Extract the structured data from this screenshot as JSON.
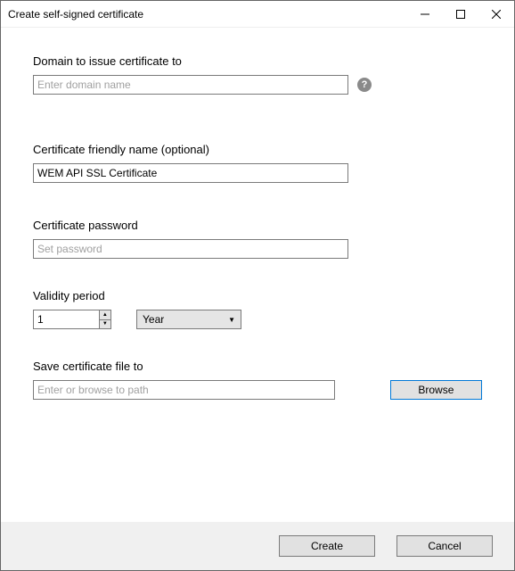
{
  "window": {
    "title": "Create self-signed certificate"
  },
  "fields": {
    "domain": {
      "label": "Domain to issue certificate to",
      "placeholder": "Enter domain name",
      "value": ""
    },
    "friendlyName": {
      "label": "Certificate friendly name (optional)",
      "value": "WEM API SSL Certificate"
    },
    "password": {
      "label": "Certificate password",
      "placeholder": "Set password",
      "value": ""
    },
    "validity": {
      "label": "Validity period",
      "number": "1",
      "unit": "Year"
    },
    "savePath": {
      "label": "Save certificate file to",
      "placeholder": "Enter or browse to path",
      "value": ""
    }
  },
  "buttons": {
    "browse": "Browse",
    "create": "Create",
    "cancel": "Cancel"
  },
  "help": {
    "domainTooltip": "?"
  }
}
